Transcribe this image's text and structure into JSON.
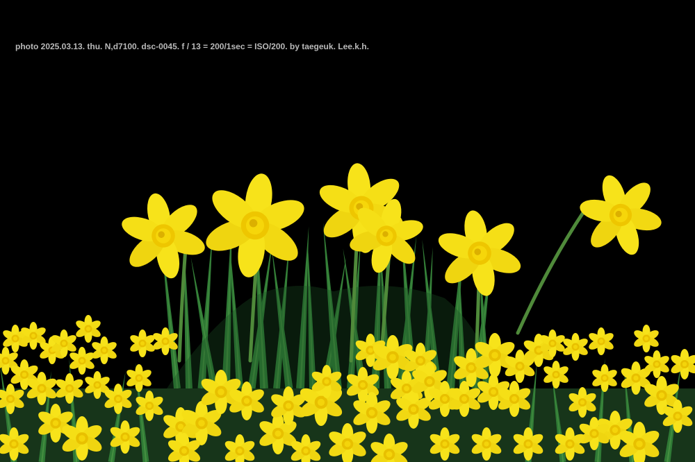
{
  "photo": {
    "caption": "photo 2025.03.13. thu. N,d7100. dsc-0045. f / 13 = 200/1sec = ISO/200. by taegeuk. Lee.k.h.",
    "subject": "daffodils",
    "colors": {
      "background": "#000000",
      "caption_text": "#b9b9b9",
      "petal": "#f7e31a",
      "petal_shade": "#e9c400",
      "trumpet": "#f0c800",
      "leaf": "#2f7a35",
      "leaf_dark": "#1b4d22",
      "stem": "#4f8a3a"
    }
  }
}
